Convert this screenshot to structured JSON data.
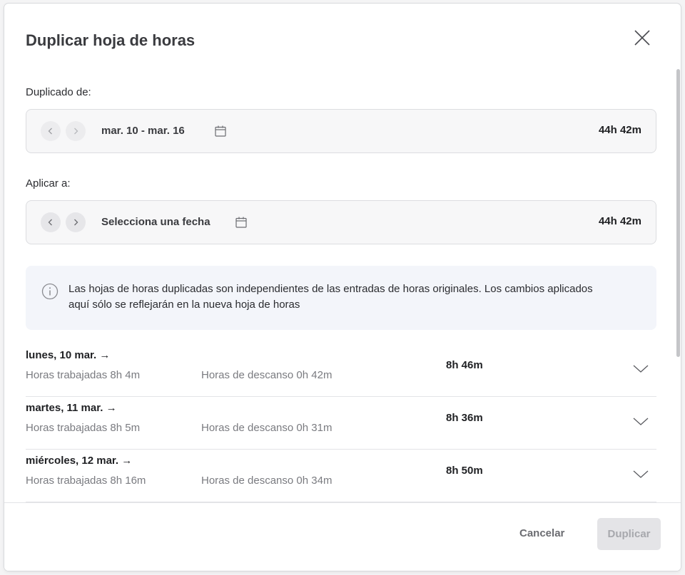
{
  "dialog": {
    "title": "Duplicar hoja de horas"
  },
  "source": {
    "label": "Duplicado de:",
    "week_range": "mar. 10 - mar. 16",
    "total": "44h 42m"
  },
  "target": {
    "label": "Aplicar a:",
    "week_range": "Selecciona una fecha",
    "total": "44h 42m"
  },
  "info": {
    "text": "Las hojas de horas duplicadas son independientes de las entradas de horas originales. Los cambios aplicados aquí sólo se reflejarán en la nueva hoja de horas"
  },
  "days": [
    {
      "title": "lunes, 10 mar. →",
      "worked": "Horas trabajadas 8h 4m",
      "break": "Horas de descanso 0h 42m",
      "total": "8h 46m"
    },
    {
      "title": "martes, 11 mar. →",
      "worked": "Horas trabajadas 8h 5m",
      "break": "Horas de descanso 0h 31m",
      "total": "8h 36m"
    },
    {
      "title": "miércoles, 12 mar. →",
      "worked": "Horas trabajadas 8h 16m",
      "break": "Horas de descanso 0h 34m",
      "total": "8h 50m"
    }
  ],
  "footer": {
    "cancel_label": "Cancelar",
    "duplicate_label": "Duplicar"
  },
  "colors": {
    "info_bg": "#f3f5fa",
    "disabled_button_bg": "#e4e4e7"
  }
}
